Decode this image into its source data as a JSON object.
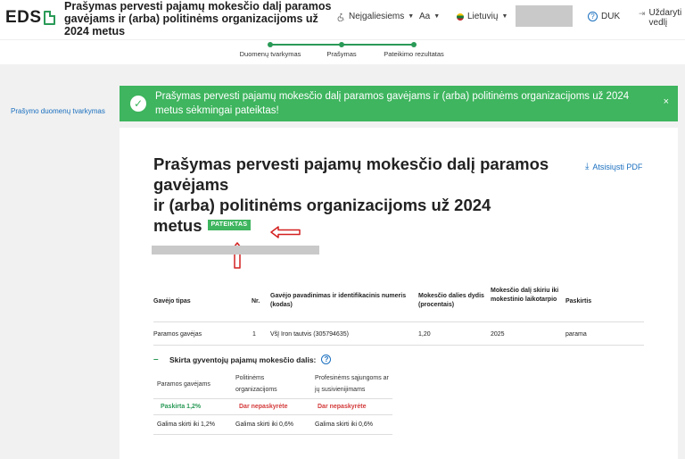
{
  "header": {
    "logo": "EDS",
    "title": "Prašymas pervesti pajamų mokesčio dalį paramos gavėjams ir (arba) politinėms organizacijoms už 2024 metus",
    "accessibility": "Neįgaliesiems",
    "font_size": "Aa",
    "language": "Lietuvių",
    "help": "DUK",
    "logout": "Uždaryti vedlį"
  },
  "stepper": {
    "steps": [
      "Duomenų tvarkymas",
      "Prašymas",
      "Pateikimo rezultatas"
    ]
  },
  "sidebar": {
    "link": "Prašymo duomenų tvarkymas"
  },
  "alert": {
    "message": "Prašymas pervesti pajamų mokesčio dalį paramos gavėjams ir (arba) politinėms organizacijoms už 2024 metus sėkmingai pateiktas!",
    "close": "×"
  },
  "document": {
    "title_line1": "Prašymas pervesti pajamų mokesčio dalį paramos gavėjams",
    "title_line2": "ir (arba) politinėms organizacijoms už 2024",
    "title_line3": "metus",
    "status": "PATEIKTAS",
    "pdf_link": "Atsisiųsti PDF"
  },
  "table": {
    "headers": [
      "Gavėjo tipas",
      "Nr.",
      "Gavėjo pavadinimas ir identifikacinis numeris (kodas)",
      "Mokesčio dalies dydis (procentais)",
      "Mokesčio dalį skiriu iki mokestinio laikotarpio",
      "Paskirtis"
    ],
    "rows": [
      [
        "Paramos gavėjas",
        "1",
        "VšĮ Iron tautvis (305794635)",
        "1,20",
        "2025",
        "parama"
      ]
    ]
  },
  "allocation": {
    "title": "Skirta gyventojų pajamų mokesčio dalis:",
    "toggle": "–",
    "columns": [
      {
        "header": "Paramos gavėjams",
        "status": "Paskirta 1,2%",
        "limit": "Galima skirti iki 1,2%"
      },
      {
        "header": "Politinėms organizacijoms",
        "status": "Dar nepaskyrėte",
        "limit": "Galima skirti iki 0,6%"
      },
      {
        "header": "Profesinėms sąjungoms ar jų susivienijimams",
        "status": "Dar nepaskyrėte",
        "limit": "Galima skirti iki 0,6%"
      }
    ]
  },
  "colors": {
    "accent_green": "#3eb55e",
    "link_blue": "#1a6fbf",
    "annotation_red": "#d42020",
    "redaction_gray": "#c9c9c9"
  }
}
